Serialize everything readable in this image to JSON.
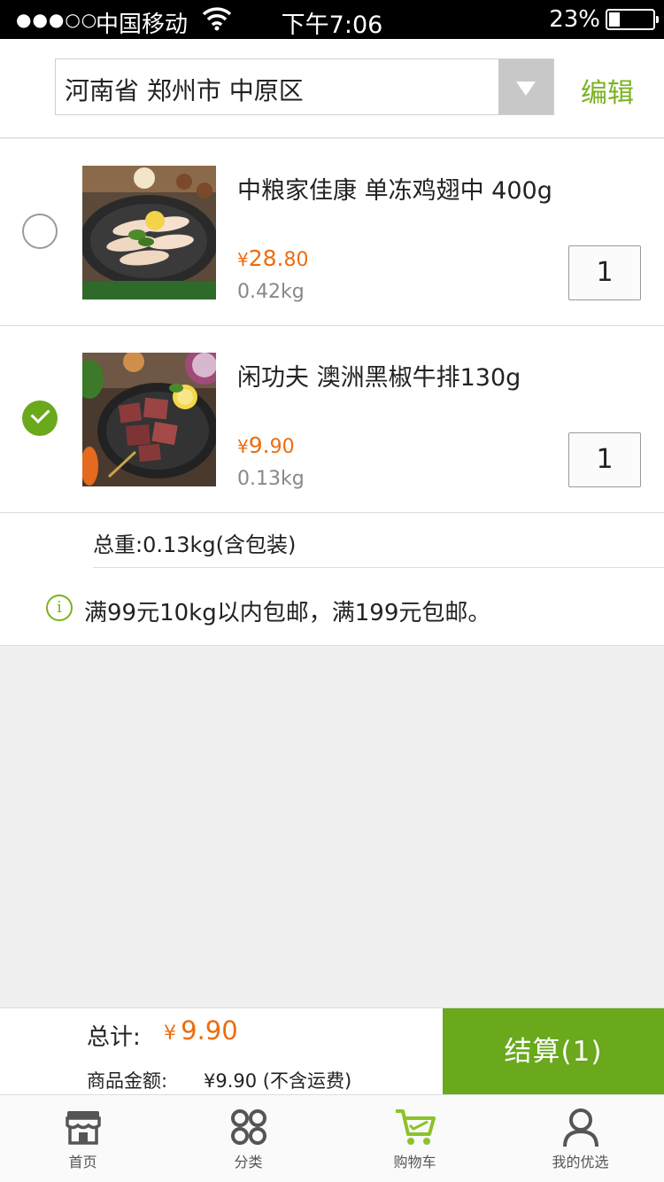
{
  "status_bar": {
    "signal": "●●●○○",
    "carrier": "中国移动",
    "time": "下午7:06",
    "battery": "23%"
  },
  "header": {
    "region": "河南省 郑州市 中原区",
    "edit_label": "编辑"
  },
  "cart": {
    "items": [
      {
        "name": "中粮家佳康 单冻鸡翅中 400g",
        "price_symbol": "¥",
        "price_main": "28.",
        "price_cents": "80",
        "weight": "0.42kg",
        "quantity": "1",
        "checked": false
      },
      {
        "name": "闲功夫 澳洲黑椒牛排130g",
        "price_symbol": "¥",
        "price_main": "9.",
        "price_cents": "90",
        "weight": "0.13kg",
        "quantity": "1",
        "checked": true
      }
    ],
    "total_weight": "总重:0.13kg(含包装)",
    "shipping_note": "满99元10kg以内包邮，满199元包邮。",
    "info_icon": "i"
  },
  "checkout": {
    "total_label": "总计:",
    "total_symbol": "¥",
    "total_value": "9.90",
    "subtotal_label": "商品金额:",
    "subtotal_value": "¥9.90 (不含运费)",
    "button_label": "结算(1)"
  },
  "tabs": [
    {
      "label": "首页",
      "icon": "store-icon",
      "active": false
    },
    {
      "label": "分类",
      "icon": "category-icon",
      "active": false
    },
    {
      "label": "购物车",
      "icon": "cart-icon",
      "active": true
    },
    {
      "label": "我的优选",
      "icon": "user-icon",
      "active": false
    }
  ],
  "colors": {
    "accent": "#6aa81c",
    "price": "#ec6d0f"
  }
}
